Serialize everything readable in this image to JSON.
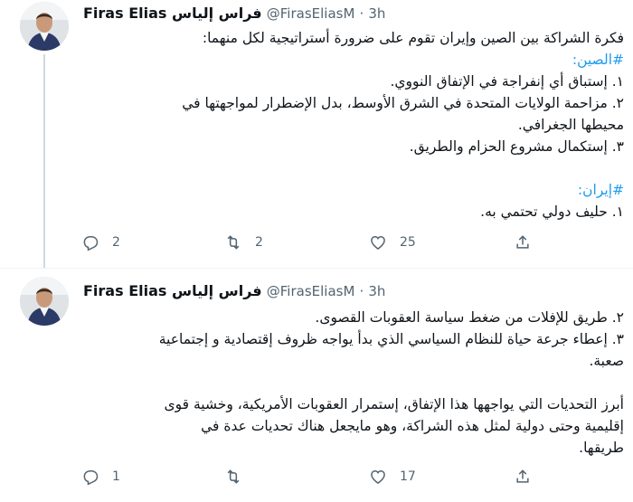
{
  "tweets": [
    {
      "display_name": "Firas Elias فراس إلياس",
      "handle": "@FirasEliasM",
      "dot": "·",
      "time": "3h",
      "lines": [
        "فكرة الشراكة بين الصين وإيران تقوم على ضرورة أستراتيجية لكل منهما:",
        "#الصين:",
        "١. إستباق أي إنفراجة في الإتفاق النووي.",
        "٢. مزاحمة الولايات المتحدة في الشرق الأوسط، بدل الإضطرار لمواجهتها في",
        "محيطها الجغرافي.",
        "٣. إستكمال مشروع الحزام والطريق.",
        "",
        "#إيران:",
        "١. حليف دولي تحتمي به."
      ],
      "replies": "2",
      "retweets": "2",
      "likes": "25"
    },
    {
      "display_name": "Firas Elias فراس إلياس",
      "handle": "@FirasEliasM",
      "dot": "·",
      "time": "3h",
      "lines": [
        "٢. طريق للإفلات من ضغط سياسة العقوبات القصوى.",
        "٣. إعطاء جرعة حياة للنظام السياسي الذي بدأ يواجه ظروف إقتصادية و إجتماعية",
        "صعبة.",
        "",
        "أبرز التحديات التي يواجهها هذا الإتفاق، إستمرار العقوبات الأمريكية، وخشية قوى",
        "إقليمية وحتى دولية لمثل هذه الشراكة، وهو مايجعل هناك تحديات عدة في",
        "طريقها."
      ],
      "replies": "1",
      "retweets": "",
      "likes": "17"
    }
  ],
  "icons": {
    "reply": "reply-icon",
    "retweet": "retweet-icon",
    "like": "heart-icon",
    "share": "share-icon"
  },
  "colors": {
    "text": "#0f1419",
    "secondary": "#536471",
    "hashtag": "#1d9bf0",
    "thread_line": "#cfd9de"
  }
}
